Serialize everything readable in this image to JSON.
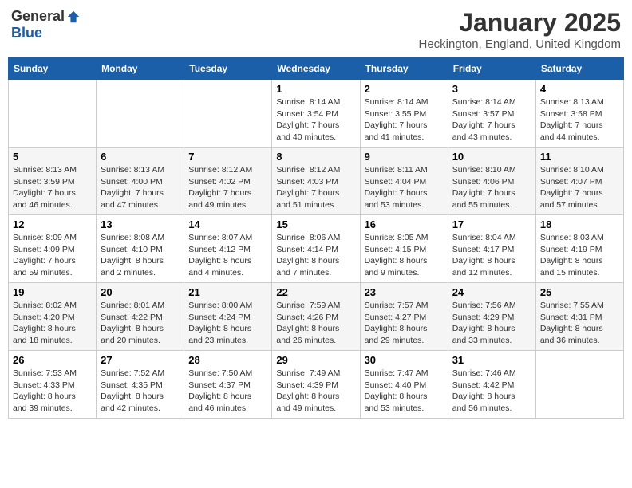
{
  "header": {
    "logo_general": "General",
    "logo_blue": "Blue",
    "title": "January 2025",
    "location": "Heckington, England, United Kingdom"
  },
  "weekdays": [
    "Sunday",
    "Monday",
    "Tuesday",
    "Wednesday",
    "Thursday",
    "Friday",
    "Saturday"
  ],
  "weeks": [
    [
      {
        "day": "",
        "sunrise": "",
        "sunset": "",
        "daylight": ""
      },
      {
        "day": "",
        "sunrise": "",
        "sunset": "",
        "daylight": ""
      },
      {
        "day": "",
        "sunrise": "",
        "sunset": "",
        "daylight": ""
      },
      {
        "day": "1",
        "sunrise": "Sunrise: 8:14 AM",
        "sunset": "Sunset: 3:54 PM",
        "daylight": "Daylight: 7 hours and 40 minutes."
      },
      {
        "day": "2",
        "sunrise": "Sunrise: 8:14 AM",
        "sunset": "Sunset: 3:55 PM",
        "daylight": "Daylight: 7 hours and 41 minutes."
      },
      {
        "day": "3",
        "sunrise": "Sunrise: 8:14 AM",
        "sunset": "Sunset: 3:57 PM",
        "daylight": "Daylight: 7 hours and 43 minutes."
      },
      {
        "day": "4",
        "sunrise": "Sunrise: 8:13 AM",
        "sunset": "Sunset: 3:58 PM",
        "daylight": "Daylight: 7 hours and 44 minutes."
      }
    ],
    [
      {
        "day": "5",
        "sunrise": "Sunrise: 8:13 AM",
        "sunset": "Sunset: 3:59 PM",
        "daylight": "Daylight: 7 hours and 46 minutes."
      },
      {
        "day": "6",
        "sunrise": "Sunrise: 8:13 AM",
        "sunset": "Sunset: 4:00 PM",
        "daylight": "Daylight: 7 hours and 47 minutes."
      },
      {
        "day": "7",
        "sunrise": "Sunrise: 8:12 AM",
        "sunset": "Sunset: 4:02 PM",
        "daylight": "Daylight: 7 hours and 49 minutes."
      },
      {
        "day": "8",
        "sunrise": "Sunrise: 8:12 AM",
        "sunset": "Sunset: 4:03 PM",
        "daylight": "Daylight: 7 hours and 51 minutes."
      },
      {
        "day": "9",
        "sunrise": "Sunrise: 8:11 AM",
        "sunset": "Sunset: 4:04 PM",
        "daylight": "Daylight: 7 hours and 53 minutes."
      },
      {
        "day": "10",
        "sunrise": "Sunrise: 8:10 AM",
        "sunset": "Sunset: 4:06 PM",
        "daylight": "Daylight: 7 hours and 55 minutes."
      },
      {
        "day": "11",
        "sunrise": "Sunrise: 8:10 AM",
        "sunset": "Sunset: 4:07 PM",
        "daylight": "Daylight: 7 hours and 57 minutes."
      }
    ],
    [
      {
        "day": "12",
        "sunrise": "Sunrise: 8:09 AM",
        "sunset": "Sunset: 4:09 PM",
        "daylight": "Daylight: 7 hours and 59 minutes."
      },
      {
        "day": "13",
        "sunrise": "Sunrise: 8:08 AM",
        "sunset": "Sunset: 4:10 PM",
        "daylight": "Daylight: 8 hours and 2 minutes."
      },
      {
        "day": "14",
        "sunrise": "Sunrise: 8:07 AM",
        "sunset": "Sunset: 4:12 PM",
        "daylight": "Daylight: 8 hours and 4 minutes."
      },
      {
        "day": "15",
        "sunrise": "Sunrise: 8:06 AM",
        "sunset": "Sunset: 4:14 PM",
        "daylight": "Daylight: 8 hours and 7 minutes."
      },
      {
        "day": "16",
        "sunrise": "Sunrise: 8:05 AM",
        "sunset": "Sunset: 4:15 PM",
        "daylight": "Daylight: 8 hours and 9 minutes."
      },
      {
        "day": "17",
        "sunrise": "Sunrise: 8:04 AM",
        "sunset": "Sunset: 4:17 PM",
        "daylight": "Daylight: 8 hours and 12 minutes."
      },
      {
        "day": "18",
        "sunrise": "Sunrise: 8:03 AM",
        "sunset": "Sunset: 4:19 PM",
        "daylight": "Daylight: 8 hours and 15 minutes."
      }
    ],
    [
      {
        "day": "19",
        "sunrise": "Sunrise: 8:02 AM",
        "sunset": "Sunset: 4:20 PM",
        "daylight": "Daylight: 8 hours and 18 minutes."
      },
      {
        "day": "20",
        "sunrise": "Sunrise: 8:01 AM",
        "sunset": "Sunset: 4:22 PM",
        "daylight": "Daylight: 8 hours and 20 minutes."
      },
      {
        "day": "21",
        "sunrise": "Sunrise: 8:00 AM",
        "sunset": "Sunset: 4:24 PM",
        "daylight": "Daylight: 8 hours and 23 minutes."
      },
      {
        "day": "22",
        "sunrise": "Sunrise: 7:59 AM",
        "sunset": "Sunset: 4:26 PM",
        "daylight": "Daylight: 8 hours and 26 minutes."
      },
      {
        "day": "23",
        "sunrise": "Sunrise: 7:57 AM",
        "sunset": "Sunset: 4:27 PM",
        "daylight": "Daylight: 8 hours and 29 minutes."
      },
      {
        "day": "24",
        "sunrise": "Sunrise: 7:56 AM",
        "sunset": "Sunset: 4:29 PM",
        "daylight": "Daylight: 8 hours and 33 minutes."
      },
      {
        "day": "25",
        "sunrise": "Sunrise: 7:55 AM",
        "sunset": "Sunset: 4:31 PM",
        "daylight": "Daylight: 8 hours and 36 minutes."
      }
    ],
    [
      {
        "day": "26",
        "sunrise": "Sunrise: 7:53 AM",
        "sunset": "Sunset: 4:33 PM",
        "daylight": "Daylight: 8 hours and 39 minutes."
      },
      {
        "day": "27",
        "sunrise": "Sunrise: 7:52 AM",
        "sunset": "Sunset: 4:35 PM",
        "daylight": "Daylight: 8 hours and 42 minutes."
      },
      {
        "day": "28",
        "sunrise": "Sunrise: 7:50 AM",
        "sunset": "Sunset: 4:37 PM",
        "daylight": "Daylight: 8 hours and 46 minutes."
      },
      {
        "day": "29",
        "sunrise": "Sunrise: 7:49 AM",
        "sunset": "Sunset: 4:39 PM",
        "daylight": "Daylight: 8 hours and 49 minutes."
      },
      {
        "day": "30",
        "sunrise": "Sunrise: 7:47 AM",
        "sunset": "Sunset: 4:40 PM",
        "daylight": "Daylight: 8 hours and 53 minutes."
      },
      {
        "day": "31",
        "sunrise": "Sunrise: 7:46 AM",
        "sunset": "Sunset: 4:42 PM",
        "daylight": "Daylight: 8 hours and 56 minutes."
      },
      {
        "day": "",
        "sunrise": "",
        "sunset": "",
        "daylight": ""
      }
    ]
  ]
}
